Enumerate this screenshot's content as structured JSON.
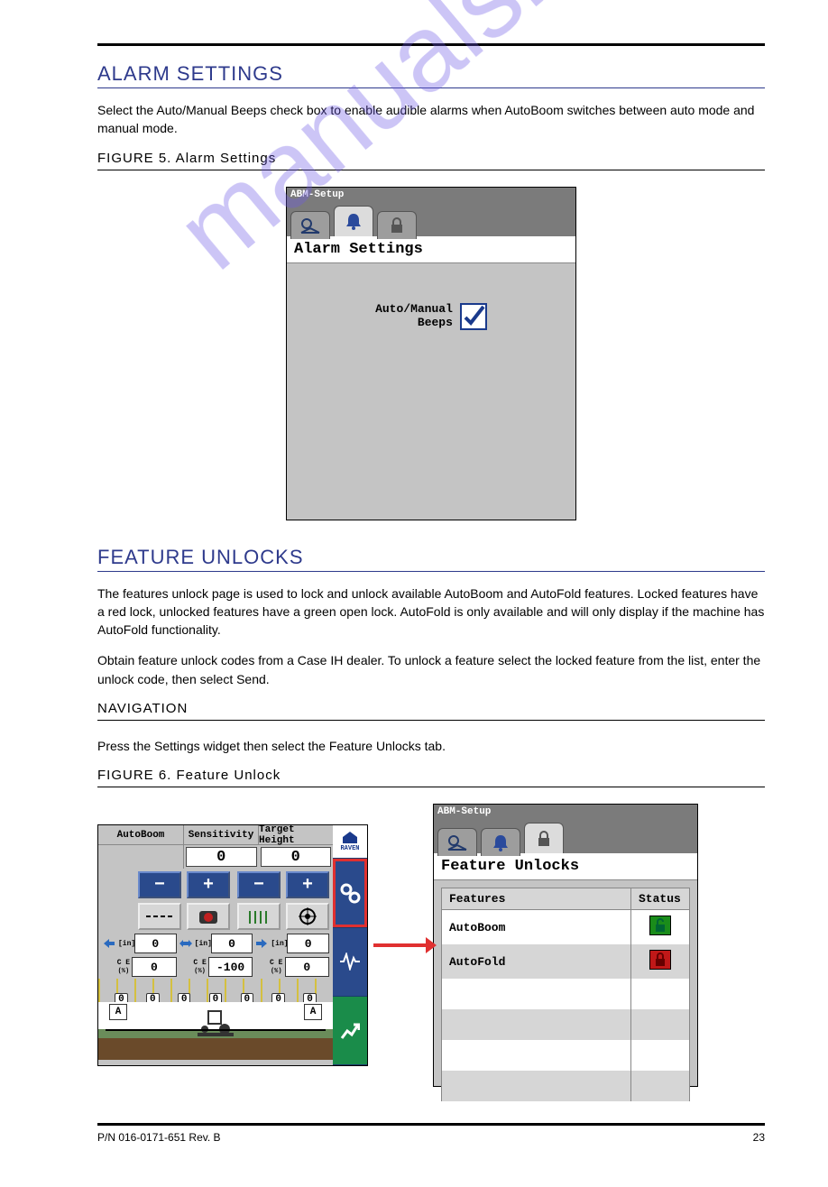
{
  "sections": {
    "alarm": {
      "heading": "ALARM SETTINGS",
      "body": "Select the Auto/Manual Beeps check box to enable audible alarms when AutoBoom switches between auto mode and manual mode.",
      "figure_title": "FIGURE 5. Alarm Settings"
    },
    "feature": {
      "heading": "FEATURE UNLOCKS",
      "body1": "The features unlock page is used to lock and unlock available AutoBoom and AutoFold features. Locked features have a red lock, unlocked features have a green open lock. AutoFold is only available and will only display if the machine has AutoFold functionality.",
      "body2": "Obtain feature unlock codes from a Case IH dealer. To unlock a feature select the locked feature from the list, enter the unlock code, then select Send.",
      "step_head": "NAVIGATION",
      "step_text": "Press the Settings widget then select the Feature Unlocks tab.",
      "figure_title": "FIGURE 6. Feature Unlock"
    }
  },
  "alarm_screen": {
    "window_title": "ABM-Setup",
    "page_title": "Alarm Settings",
    "checkbox_label_l1": "Auto/Manual",
    "checkbox_label_l2": "Beeps",
    "checked": true
  },
  "main_screen": {
    "title": "AutoBoom",
    "col1": "Sensitivity",
    "col2": "Target Height",
    "sensitivity_value": "0",
    "target_height_value": "0",
    "row1": {
      "left": "0",
      "mid": "0",
      "right": "0",
      "unit": "[in]"
    },
    "row2": {
      "left": "0",
      "mid": "-100",
      "right": "0",
      "unit": "C E",
      "unit2": "(%)"
    },
    "nozzle_values": [
      "0",
      "0",
      "0",
      "0",
      "0",
      "0",
      "0"
    ],
    "side_home": "RAVEN",
    "a_badge": "A"
  },
  "feature_screen": {
    "window_title": "ABM-Setup",
    "page_title": "Feature Unlocks",
    "col_features": "Features",
    "col_status": "Status",
    "rows": [
      {
        "name": "AutoBoom",
        "status": "unlocked"
      },
      {
        "name": "AutoFold",
        "status": "locked"
      }
    ]
  },
  "footer": {
    "left": "P/N 016-0171-651 Rev. B",
    "right": "23"
  },
  "watermark": "manualshive.com"
}
